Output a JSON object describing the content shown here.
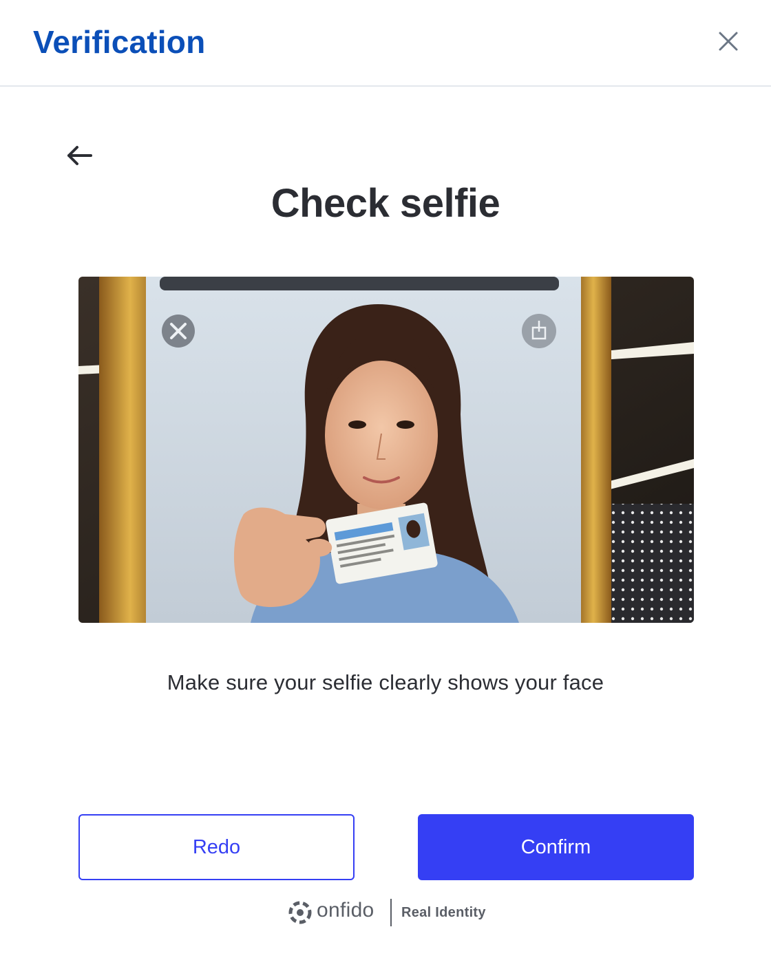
{
  "header": {
    "title": "Verification",
    "close_icon": "close-icon"
  },
  "nav": {
    "back_icon": "arrow-left-icon"
  },
  "main": {
    "title": "Check selfie",
    "image_alt": "selfie-photo",
    "hint": "Make sure your selfie clearly shows your face"
  },
  "actions": {
    "redo_label": "Redo",
    "confirm_label": "Confirm"
  },
  "footer": {
    "brand": "onfido",
    "tagline": "Real Identity",
    "logo_icon": "onfido-logo-icon"
  },
  "colors": {
    "brand_title": "#0b4fb8",
    "accent": "#353ff4",
    "text": "#2b2d33",
    "muted": "#5a5e66"
  }
}
